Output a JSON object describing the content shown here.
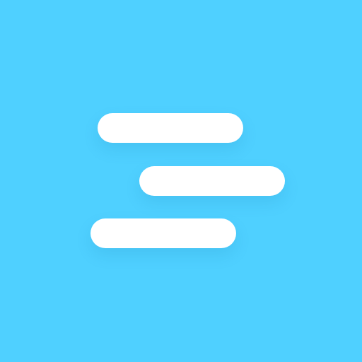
{
  "icon": {
    "name": "staggered-lines-icon",
    "background_color": "#4fd0ff",
    "bar_color": "#ffffff"
  }
}
